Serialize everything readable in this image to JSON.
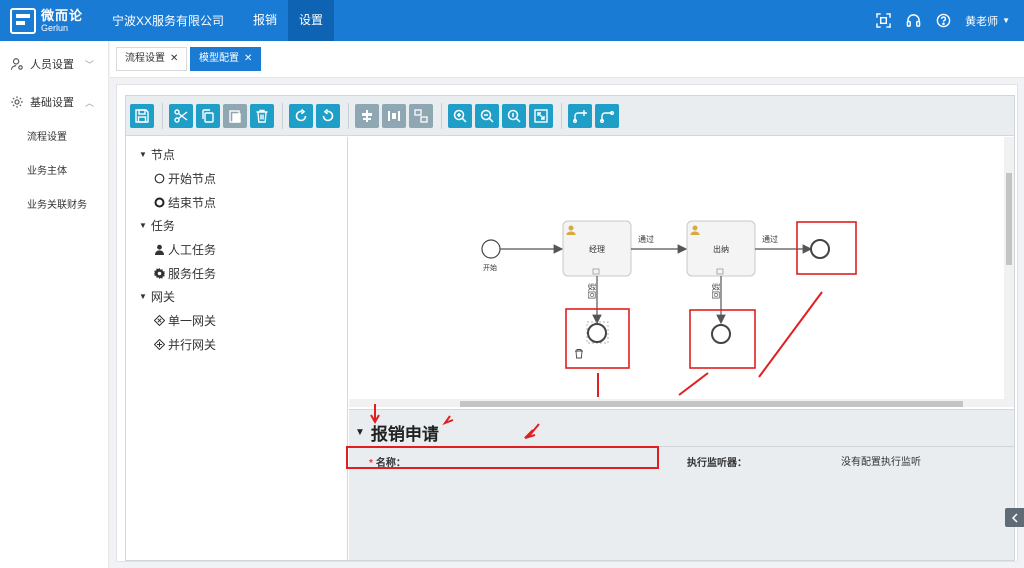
{
  "header": {
    "logo_cn": "微而论",
    "logo_en": "Gerlun",
    "company": "宁波XX服务有限公司",
    "nav": [
      {
        "label": "报销",
        "active": false
      },
      {
        "label": "设置",
        "active": true
      }
    ],
    "user": "黄老师",
    "icons": [
      "scan-icon",
      "headset-icon",
      "help-icon",
      "caret-down-icon"
    ],
    "brand_color": "#1a7bd5"
  },
  "sidebar": {
    "groups": [
      {
        "label": "人员设置",
        "icon": "user-icon",
        "expanded": false,
        "items": []
      },
      {
        "label": "基础设置",
        "icon": "gear-icon",
        "expanded": true,
        "items": [
          "流程设置",
          "业务主体",
          "业务关联财务"
        ]
      }
    ]
  },
  "tabs": [
    {
      "label": "流程设置",
      "active": false
    },
    {
      "label": "模型配置",
      "active": true
    }
  ],
  "toolbar": {
    "buttons": [
      "save-icon",
      "cut-icon",
      "copy-icon",
      "paste-icon",
      "delete-icon",
      "redo-icon",
      "undo-icon",
      "align-icon",
      "distribute-icon",
      "resize-icon",
      "zoom-in-icon",
      "zoom-out-icon",
      "zoom-actual-icon",
      "fit-icon",
      "add-bendpoint-icon",
      "remove-bendpoint-icon"
    ]
  },
  "palette": {
    "groups": [
      {
        "label": "节点",
        "items": [
          {
            "label": "开始节点",
            "icon": "circle-icon"
          },
          {
            "label": "结束节点",
            "icon": "bold-circle-icon"
          }
        ]
      },
      {
        "label": "任务",
        "items": [
          {
            "label": "人工任务",
            "icon": "person-icon"
          },
          {
            "label": "服务任务",
            "icon": "gear-icon"
          }
        ]
      },
      {
        "label": "网关",
        "items": [
          {
            "label": "单一网关",
            "icon": "exclusive-gateway-icon"
          },
          {
            "label": "并行网关",
            "icon": "parallel-gateway-icon"
          }
        ]
      }
    ]
  },
  "diagram": {
    "start_label": "开始",
    "task1_label": "经理",
    "task2_label": "出纳",
    "flow_pass_1": "通过",
    "flow_pass_2": "通过",
    "flow_reject_1": "驳回",
    "flow_reject_2": "驳回",
    "highlight_color": "#e02020"
  },
  "properties": {
    "title": "报销申请",
    "name_label": "名称：",
    "name_value": "",
    "listener_label": "执行监听器：",
    "listener_value": "没有配置执行监听"
  }
}
